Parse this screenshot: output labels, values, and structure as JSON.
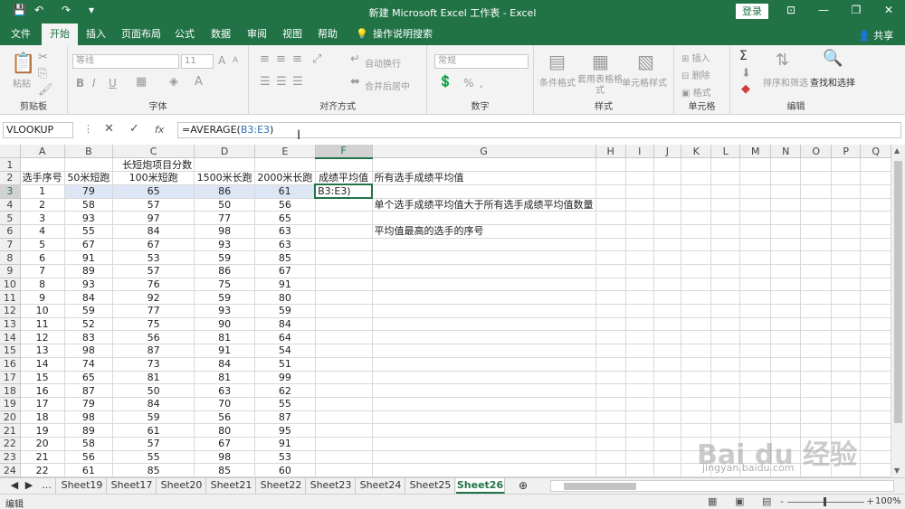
{
  "titlebar": {
    "title": "新建 Microsoft Excel 工作表 - Excel",
    "login": "登录",
    "quick_save": "💾",
    "quick_undo": "↶",
    "quick_redo": "↷",
    "quick_more": "▾",
    "win_ribbon": "⊡",
    "win_min": "—",
    "win_max": "❐",
    "win_close": "✕"
  },
  "tabs": [
    "文件",
    "开始",
    "插入",
    "页面布局",
    "公式",
    "数据",
    "审阅",
    "视图",
    "帮助"
  ],
  "active_tab": "开始",
  "tell_me": "操作说明搜索",
  "share": "共享",
  "ribbon": {
    "clipboard": {
      "label": "剪贴板",
      "paste": "粘贴"
    },
    "font": {
      "label": "字体",
      "font_name": "等线",
      "font_size": "11",
      "bold": "B",
      "italic": "I",
      "underline": "U",
      "grow": "A",
      "shrink": "A"
    },
    "align": {
      "label": "对齐方式",
      "wrap": "自动换行",
      "merge": "合并后居中"
    },
    "number": {
      "label": "数字",
      "format": "常规",
      "pct": "%",
      "comma": ","
    },
    "styles": {
      "label": "样式",
      "cond": "条件格式",
      "table": "套用表格格式",
      "cell": "单元格样式"
    },
    "cells": {
      "label": "单元格",
      "insert": "插入",
      "delete": "删除",
      "format": "格式"
    },
    "edit": {
      "label": "编辑",
      "sort": "排序和筛选",
      "find": "查找和选择",
      "sigma": "Σ"
    }
  },
  "formula_bar": {
    "name_box": "VLOOKUP",
    "cancel": "✕",
    "enter": "✓",
    "fx": "fx",
    "formula_prefix": "=AVERAGE(",
    "formula_ref": "B3:E3",
    "formula_suffix": ")"
  },
  "columns": [
    "A",
    "B",
    "C",
    "D",
    "E",
    "F",
    "G",
    "H",
    "I",
    "J",
    "K",
    "L",
    "M",
    "N",
    "O",
    "P",
    "Q"
  ],
  "sheet": {
    "title": "长短炮项目分数",
    "headers": [
      "选手序号",
      "50米短跑",
      "100米短跑",
      "1500米长跑",
      "2000米长跑",
      "成绩平均值"
    ],
    "editing_cell_text": "B3:E3)",
    "notes": {
      "g2": "所有选手成绩平均值",
      "g4": "单个选手成绩平均值大于所有选手成绩平均值数量",
      "g6": "平均值最高的选手的序号"
    },
    "rows": [
      [
        1,
        79,
        65,
        86,
        61
      ],
      [
        2,
        58,
        57,
        50,
        56
      ],
      [
        3,
        93,
        97,
        77,
        65
      ],
      [
        4,
        55,
        84,
        98,
        63
      ],
      [
        5,
        67,
        67,
        93,
        63
      ],
      [
        6,
        91,
        53,
        59,
        85
      ],
      [
        7,
        89,
        57,
        86,
        67
      ],
      [
        8,
        93,
        76,
        75,
        91
      ],
      [
        9,
        84,
        92,
        59,
        80
      ],
      [
        10,
        59,
        77,
        93,
        59
      ],
      [
        11,
        52,
        75,
        90,
        84
      ],
      [
        12,
        83,
        56,
        81,
        64
      ],
      [
        13,
        98,
        87,
        91,
        54
      ],
      [
        14,
        74,
        73,
        84,
        51
      ],
      [
        15,
        65,
        81,
        81,
        99
      ],
      [
        16,
        87,
        50,
        63,
        62
      ],
      [
        17,
        79,
        84,
        70,
        55
      ],
      [
        18,
        98,
        59,
        56,
        87
      ],
      [
        19,
        89,
        61,
        80,
        95
      ],
      [
        20,
        58,
        57,
        67,
        91
      ],
      [
        21,
        56,
        55,
        98,
        53
      ],
      [
        22,
        61,
        85,
        85,
        60
      ]
    ]
  },
  "sheet_tabs": [
    "Sheet19",
    "Sheet17",
    "Sheet20",
    "Sheet21",
    "Sheet22",
    "Sheet23",
    "Sheet24",
    "Sheet25",
    "Sheet26"
  ],
  "active_sheet": "Sheet26",
  "sheet_nav_more": "...",
  "add_sheet": "⊕",
  "status": {
    "mode": "编辑",
    "zoom": "100%",
    "zoom_minus": "-",
    "zoom_plus": "+"
  },
  "watermark": {
    "brand": "Bai du 经验",
    "url": "jingyan.baidu.com"
  }
}
